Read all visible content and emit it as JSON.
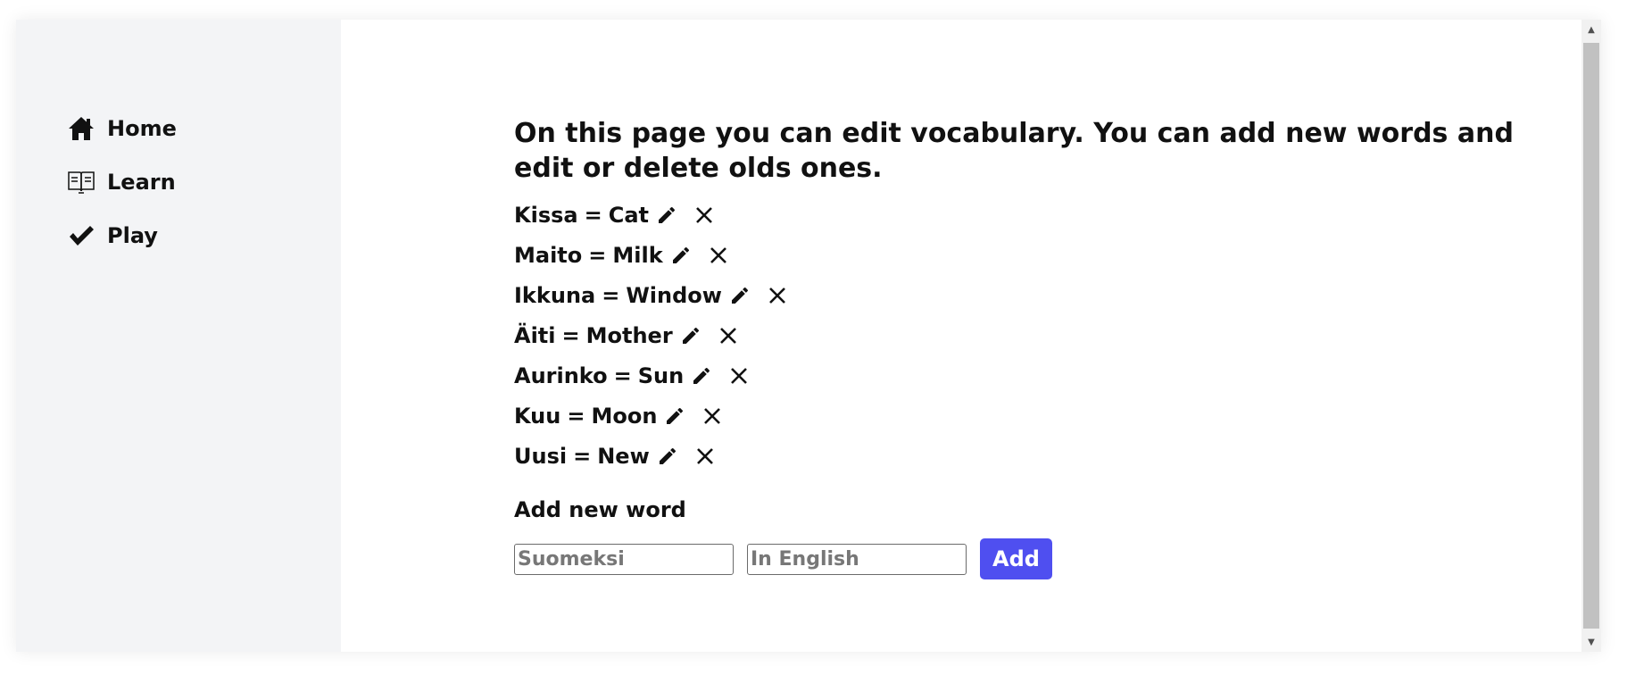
{
  "nav": {
    "items": [
      {
        "label": "Home",
        "icon": "home-icon"
      },
      {
        "label": "Learn",
        "icon": "book-icon"
      },
      {
        "label": "Play",
        "icon": "check-icon"
      }
    ]
  },
  "main": {
    "intro": "On this page you can edit vocabulary. You can add new words and edit or delete olds ones.",
    "equals": "=",
    "words": [
      {
        "fi": "Kissa",
        "en": "Cat"
      },
      {
        "fi": "Maito",
        "en": "Milk"
      },
      {
        "fi": "Ikkuna",
        "en": "Window"
      },
      {
        "fi": "Äiti",
        "en": "Mother"
      },
      {
        "fi": "Aurinko",
        "en": "Sun"
      },
      {
        "fi": "Kuu",
        "en": "Moon"
      },
      {
        "fi": "Uusi",
        "en": "New"
      }
    ],
    "add_title": "Add new word",
    "finnish_placeholder": "Suomeksi",
    "english_placeholder": "In English",
    "add_label": "Add"
  },
  "colors": {
    "sidebar_bg": "#f3f4f6",
    "accent": "#4f4ff0",
    "text": "#111111"
  }
}
